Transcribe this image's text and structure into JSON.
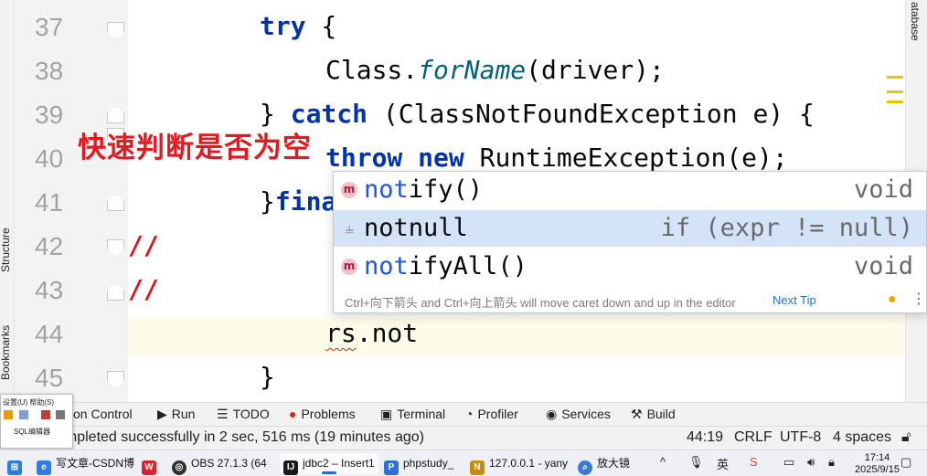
{
  "editor": {
    "line_numbers": [
      "37",
      "38",
      "39",
      "40",
      "41",
      "42",
      "43",
      "44",
      "45"
    ],
    "lines": {
      "l37_kw": "try",
      "l37_rest": " {",
      "l38_a": "Class.",
      "l38_b": "forName",
      "l38_c": "(driver);",
      "l39_a": "} ",
      "l39_kw": "catch",
      "l39_b": " (ClassNotFoundException e) {",
      "l40_kw1": "throw",
      "l40_kw2": "new",
      "l40_rest": "RuntimeException(e);",
      "l41_a": "}",
      "l41_kw": "fina",
      "l42": "//",
      "l43": "//",
      "l44_a": "rs",
      "l44_b": ".not",
      "l45": "}"
    }
  },
  "overlay_caption": "快速判断是否为空",
  "completion": {
    "items": [
      {
        "match": "not",
        "rest": "ify()",
        "type": "void",
        "icon": "m"
      },
      {
        "match": "not",
        "rest": "null",
        "type": "if (expr != null)",
        "icon": "template"
      },
      {
        "match": "not",
        "rest": "ifyAll()",
        "type": "void",
        "icon": "m"
      }
    ],
    "hint": "Ctrl+向下箭头 and Ctrl+向上箭头 will move caret down and up in the editor",
    "next_tip": "Next Tip"
  },
  "side_panels": {
    "structure": "Structure",
    "bookmarks": "Bookmarks",
    "database": "atabase"
  },
  "tool_windows": {
    "version_control": "on Control",
    "run": "Run",
    "todo": "TODO",
    "problems": "Problems",
    "terminal": "Terminal",
    "profiler": "Profiler",
    "services": "Services",
    "build": "Build"
  },
  "status": {
    "message": "ompleted successfully in 2 sec, 516 ms (19 minutes ago)",
    "position": "44:19",
    "line_sep": "CRLF",
    "encoding": "UTF-8",
    "indent": "4 spaces"
  },
  "mini_window": {
    "menu": "设置(U)   帮助(S)",
    "label": "SQL编辑器"
  },
  "taskbar": {
    "items": [
      {
        "label": "写文章-CSDN博",
        "color": "#2f7de1"
      },
      {
        "label": "",
        "color": "#d8232a"
      },
      {
        "label": "OBS 27.1.3 (64",
        "color": "#303030"
      },
      {
        "label": "jdbc2 – Insert1",
        "color": "#1a1a1a"
      },
      {
        "label": "phpstudy_",
        "color": "#2d6ed8"
      },
      {
        "label": "127.0.0.1 - yany",
        "color": "#c98a10"
      },
      {
        "label": "放大镜",
        "color": "#3a7bd5"
      }
    ],
    "tray": {
      "ime": "英",
      "time": "17:14",
      "date": "2025/9/15"
    }
  },
  "colors": {
    "keyword": "#0033b3",
    "method_italic": "#00627a",
    "selection": "#d5e3f8",
    "caption": "#e8171e",
    "current_line": "#fefbe8"
  }
}
